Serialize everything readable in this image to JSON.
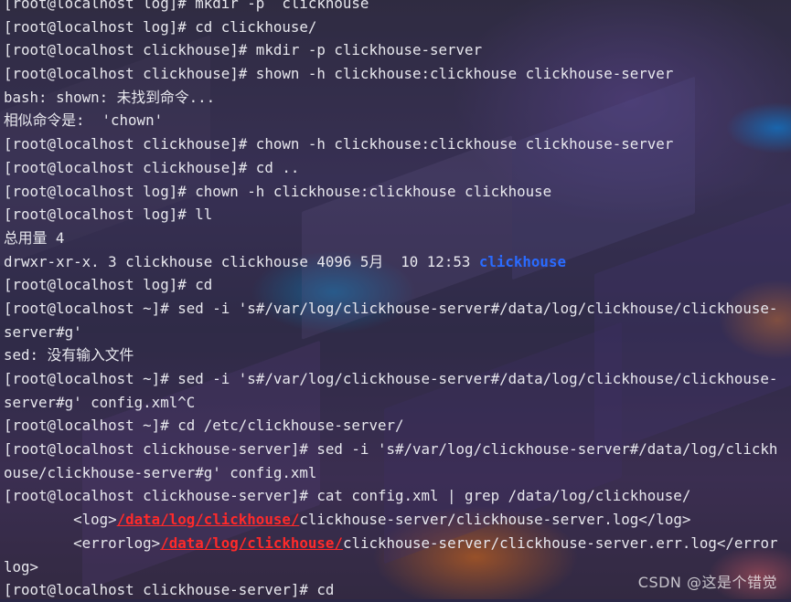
{
  "terminal": {
    "lines": [
      [
        {
          "t": "[root@localhost log]# mkdir -p  clickhouse"
        }
      ],
      [
        {
          "t": "[root@localhost log]# cd clickhouse/"
        }
      ],
      [
        {
          "t": "[root@localhost clickhouse]# mkdir -p clickhouse-server"
        }
      ],
      [
        {
          "t": "[root@localhost clickhouse]# shown -h clickhouse:clickhouse clickhouse-server"
        }
      ],
      [
        {
          "t": "bash: shown: 未找到命令..."
        }
      ],
      [
        {
          "t": "相似命令是:  'chown'"
        }
      ],
      [
        {
          "t": "[root@localhost clickhouse]# chown -h clickhouse:clickhouse clickhouse-server"
        }
      ],
      [
        {
          "t": "[root@localhost clickhouse]# cd .."
        }
      ],
      [
        {
          "t": "[root@localhost log]# chown -h clickhouse:clickhouse clickhouse"
        }
      ],
      [
        {
          "t": "[root@localhost log]# ll"
        }
      ],
      [
        {
          "t": "总用量 4"
        }
      ],
      [
        {
          "t": "drwxr-xr-x. 3 clickhouse clickhouse 4096 5月  10 12:53 "
        },
        {
          "t": "clickhouse",
          "c": "dir"
        }
      ],
      [
        {
          "t": "[root@localhost log]# cd"
        }
      ],
      [
        {
          "t": "[root@localhost ~]# sed -i 's#/var/log/clickhouse-server#/data/log/clickhouse/clickhouse-"
        }
      ],
      [
        {
          "t": "server#g'"
        }
      ],
      [
        {
          "t": "sed: 没有输入文件"
        }
      ],
      [
        {
          "t": "[root@localhost ~]# sed -i 's#/var/log/clickhouse-server#/data/log/clickhouse/clickhouse-"
        }
      ],
      [
        {
          "t": "server#g' config.xml^C"
        }
      ],
      [
        {
          "t": "[root@localhost ~]# cd /etc/clickhouse-server/"
        }
      ],
      [
        {
          "t": "[root@localhost clickhouse-server]# sed -i 's#/var/log/clickhouse-server#/data/log/clickh"
        }
      ],
      [
        {
          "t": "ouse/clickhouse-server#g' config.xml"
        }
      ],
      [
        {
          "t": "[root@localhost clickhouse-server]# cat config.xml | grep /data/log/clickhouse/"
        }
      ],
      [
        {
          "t": "        <log>"
        },
        {
          "t": "/data/log/clickhouse/",
          "c": "hl"
        },
        {
          "t": "clickhouse-server/clickhouse-server.log</log>"
        }
      ],
      [
        {
          "t": "        <errorlog>"
        },
        {
          "t": "/data/log/clickhouse/",
          "c": "hl"
        },
        {
          "t": "clickhouse-server/clickhouse-server.err.log</error"
        }
      ],
      [
        {
          "t": "log>"
        }
      ],
      [
        {
          "t": "[root@localhost clickhouse-server]# cd"
        }
      ]
    ]
  },
  "watermark": "CSDN @这是个错觉",
  "colors": {
    "text": "#e8e8ee",
    "directory": "#2a6bff",
    "grep_match": "#ff2a2a"
  }
}
